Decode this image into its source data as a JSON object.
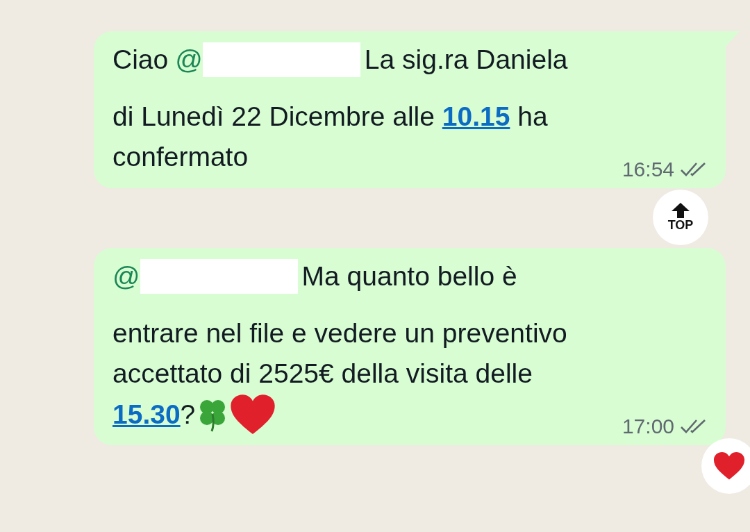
{
  "messages": [
    {
      "greeting": "Ciao",
      "mention": "@",
      "first_line": "La sig.ra Daniela",
      "tail": true,
      "lines": [
        [
          {
            "kind": "text",
            "text": "di Lunedì 22 Dicembre alle "
          },
          {
            "kind": "link",
            "text": "10.15"
          },
          {
            "kind": "text",
            "text": " ha"
          }
        ],
        [
          {
            "kind": "text",
            "text": "confermato"
          }
        ]
      ],
      "time": "16:54",
      "read": false,
      "reaction": false
    },
    {
      "mention": "@",
      "first_line": "Ma quanto bello è",
      "tail": false,
      "lines": [
        [
          {
            "kind": "text",
            "text": "entrare nel file e vedere un preventivo"
          }
        ],
        [
          {
            "kind": "text",
            "text": "accettato di 2525€ della visita delle"
          }
        ],
        [
          {
            "kind": "link",
            "text": "15.30"
          },
          {
            "kind": "text",
            "text": "?"
          },
          {
            "kind": "clover"
          },
          {
            "kind": "heart"
          }
        ]
      ],
      "time": "17:00",
      "read": false,
      "reaction": true
    }
  ],
  "top_button": {
    "label": "TOP"
  }
}
